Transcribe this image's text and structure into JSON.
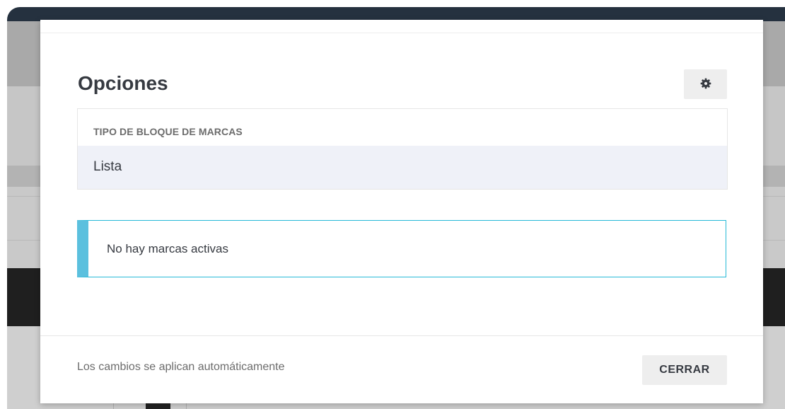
{
  "modal": {
    "title": "Opciones",
    "settings_icon": "gear-icon",
    "table": {
      "header": "TIPO DE BLOQUE DE MARCAS",
      "value": "Lista"
    },
    "alert": {
      "type": "info",
      "text": "No hay marcas activas"
    },
    "footer": {
      "note": "Los cambios se aplican automáticamente",
      "close_label": "CERRAR"
    }
  },
  "colors": {
    "alert_accent": "#5bc0de",
    "button_bg": "#eeeeee",
    "row_bg": "#eff1f8",
    "text": "#363a41"
  }
}
